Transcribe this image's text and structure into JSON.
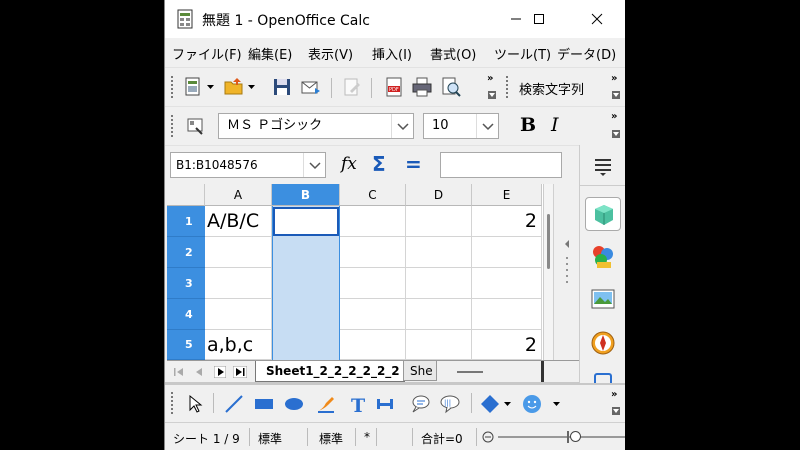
{
  "window": {
    "title": "無題 1 - OpenOffice Calc"
  },
  "menu": [
    "ファイル(F)",
    "編集(E)",
    "表示(V)",
    "挿入(I)",
    "書式(O)",
    "ツール(T)",
    "データ(D)"
  ],
  "toolbar": {
    "find_label": "検索文字列"
  },
  "format": {
    "font_name": "ＭＳ Ｐゴシック",
    "font_size": "10",
    "bold": "B",
    "italic": "I"
  },
  "formula": {
    "name_box": "B1:B1048576",
    "function_symbol": "fx",
    "sum_symbol": "Σ",
    "equals_symbol": "=",
    "input": ""
  },
  "sheet": {
    "columns": [
      "A",
      "B",
      "C",
      "D",
      "E"
    ],
    "rows": [
      {
        "num": "1",
        "a": "A/B/C",
        "e": "2"
      },
      {
        "num": "2",
        "a": "",
        "e": ""
      },
      {
        "num": "3",
        "a": "",
        "e": ""
      },
      {
        "num": "4",
        "a": "",
        "e": ""
      },
      {
        "num": "5",
        "a": "a,b,c",
        "e": "2"
      }
    ]
  },
  "tabs": {
    "active": "Sheet1_2_2_2_2_2_2",
    "next": "She"
  },
  "status": {
    "sheet": "シート 1 / 9",
    "style": "標準",
    "mode": "標準",
    "modified": "*",
    "sum": "合計=0"
  },
  "colors": {
    "accent": "#3c8fe0",
    "selection": "#c7ddf3",
    "row_header": "#3c8fe0"
  }
}
